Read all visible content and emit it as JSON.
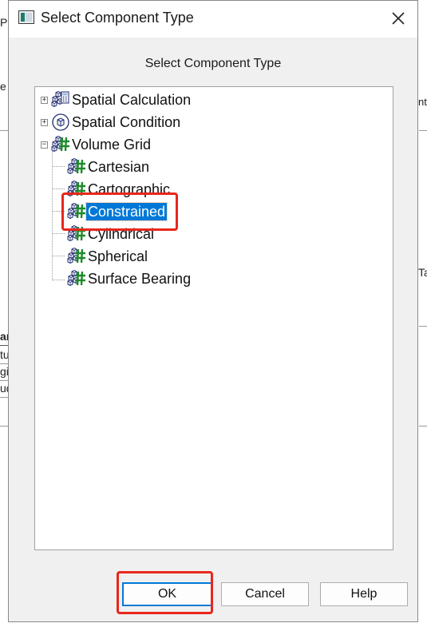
{
  "background": {
    "fragments": [
      "P",
      "e",
      "ntr",
      "Ta",
      "ar",
      "tu",
      "gi",
      "ud"
    ]
  },
  "dialog": {
    "title": "Select Component Type",
    "heading": "Select Component Type",
    "close_icon": "close-icon"
  },
  "tree": {
    "items": [
      {
        "label": "Spatial Calculation",
        "expander": "+",
        "icon": "spatial-calculation-icon"
      },
      {
        "label": "Spatial Condition",
        "expander": "+",
        "icon": "spatial-condition-icon"
      },
      {
        "label": "Volume Grid",
        "expander": "−",
        "icon": "volume-grid-icon"
      },
      {
        "label": "Cartesian",
        "icon": "volume-grid-icon"
      },
      {
        "label": "Cartographic",
        "icon": "volume-grid-icon"
      },
      {
        "label": "Constrained",
        "icon": "volume-grid-icon",
        "selected": true
      },
      {
        "label": "Cylindrical",
        "icon": "volume-grid-icon"
      },
      {
        "label": "Spherical",
        "icon": "volume-grid-icon"
      },
      {
        "label": "Surface Bearing",
        "icon": "volume-grid-icon"
      }
    ]
  },
  "buttons": {
    "ok": "OK",
    "cancel": "Cancel",
    "help": "Help"
  },
  "colors": {
    "selection": "#0078d7",
    "annotation": "#e8271c",
    "grid_icon": "#1f8a2a"
  }
}
